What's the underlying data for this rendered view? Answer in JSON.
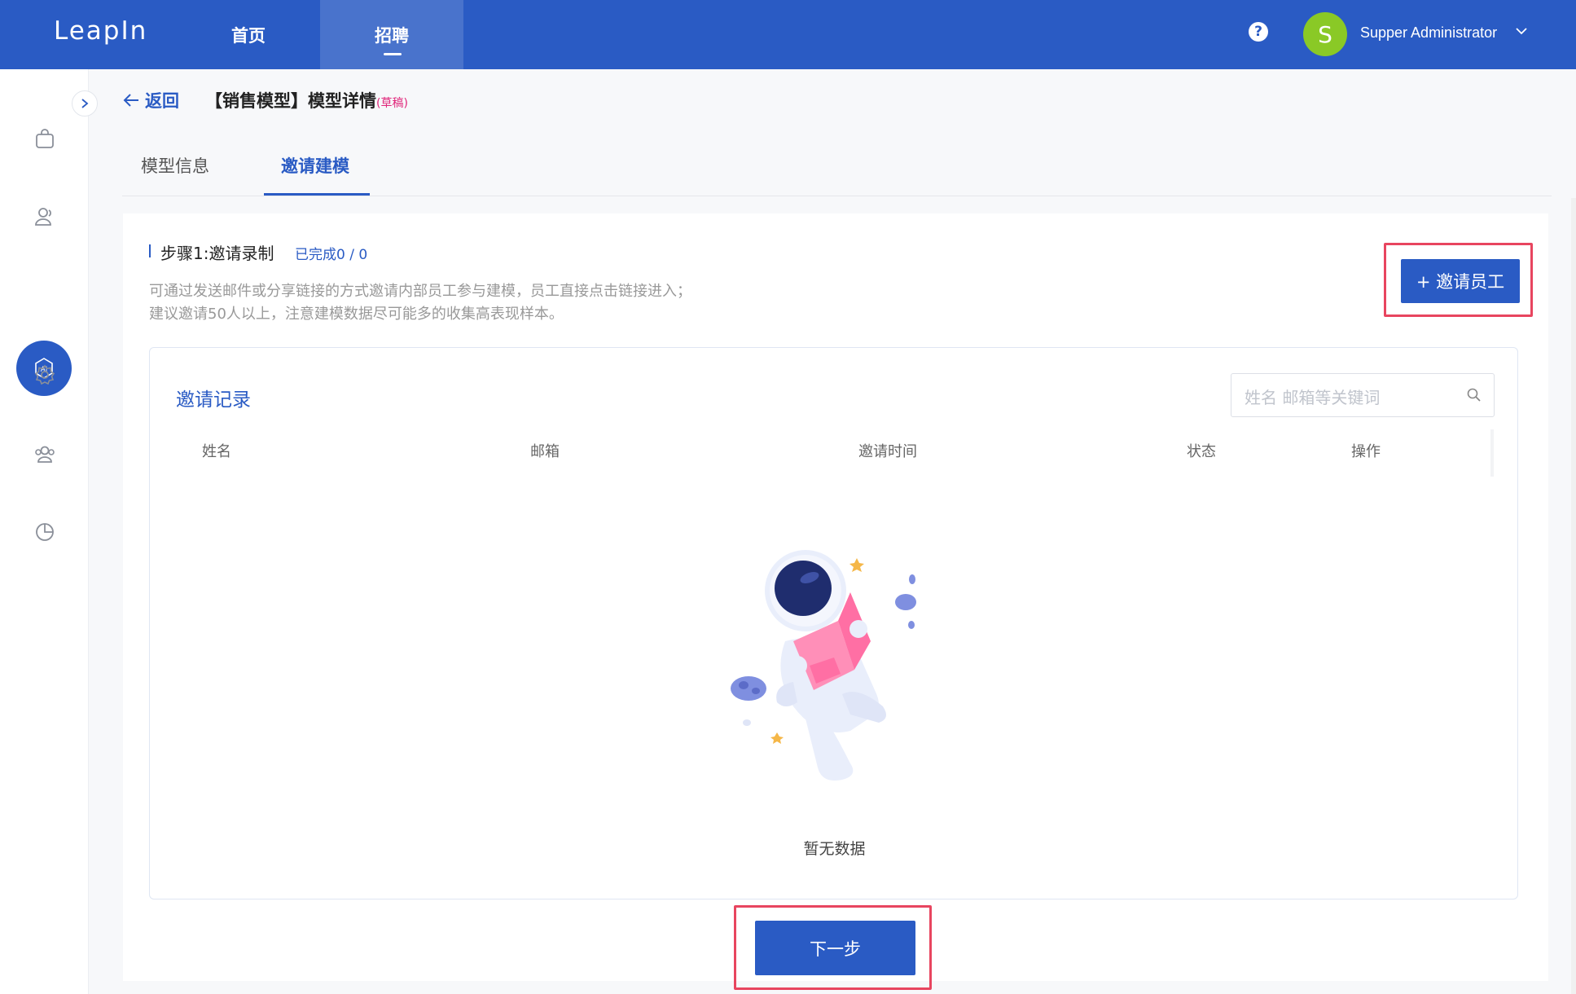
{
  "app": {
    "logo": "LeapIn"
  },
  "nav": {
    "home": "首页",
    "recruit": "招聘"
  },
  "user": {
    "avatar_letter": "S",
    "name": "Supper Administrator",
    "help": "?"
  },
  "sidebar": {
    "icons": [
      "bag-icon",
      "users-icon",
      "ai-icon",
      "settings-icon",
      "team-icon",
      "pie-chart-icon"
    ],
    "active": "ai-icon",
    "ai_label": "AI"
  },
  "header": {
    "back_label": "返回",
    "title": "【销售模型】模型详情",
    "status": "(草稿)"
  },
  "tabs": [
    {
      "label": "模型信息"
    },
    {
      "label": "邀请建模",
      "active": true
    }
  ],
  "step": {
    "title": "步骤1:邀请录制",
    "progress": "已完成0 / 0",
    "desc_line1": "可通过发送邮件或分享链接的方式邀请内部员工参与建模，员工直接点击链接进入；",
    "desc_line2": "建议邀请50人以上，注意建模数据尽可能多的收集高表现样本。",
    "invite_button": "+ 邀请员工"
  },
  "records": {
    "title": "邀请记录",
    "search_placeholder": "姓名 邮箱等关键词",
    "columns": [
      "姓名",
      "邮箱",
      "邀请时间",
      "状态",
      "操作"
    ],
    "empty_text": "暂无数据"
  },
  "footer": {
    "next_button": "下一步"
  },
  "colors": {
    "primary": "#2a5bc4",
    "highlight": "#e8455f",
    "avatar": "#8ac926",
    "draft": "#e0267a"
  }
}
